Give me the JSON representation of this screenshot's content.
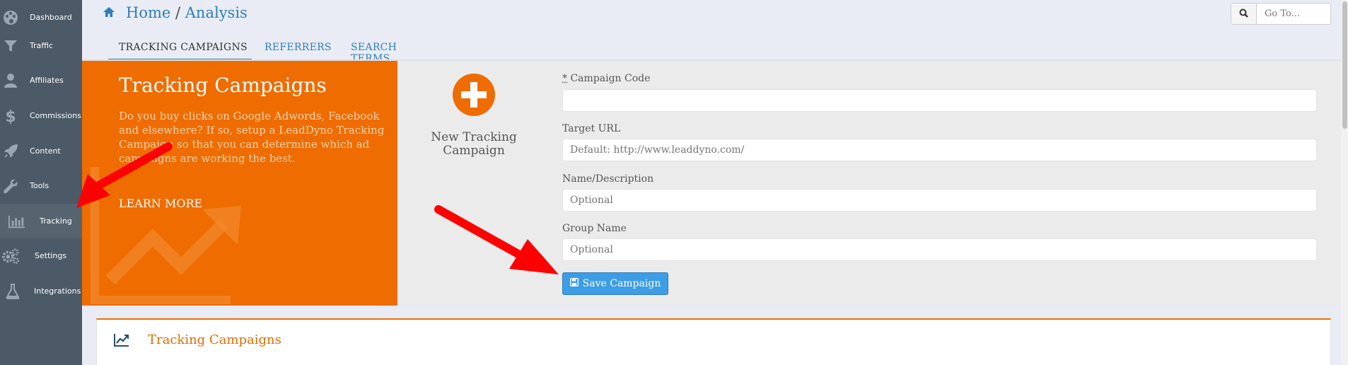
{
  "sidebar": {
    "items": [
      {
        "label": "Dashboard",
        "icon": "palette-icon"
      },
      {
        "label": "Traffic",
        "icon": "filter-icon"
      },
      {
        "label": "Affiliates",
        "icon": "user-icon"
      },
      {
        "label": "Commissions",
        "icon": "dollar-icon"
      },
      {
        "label": "Content",
        "icon": "rocket-icon"
      },
      {
        "label": "Tools",
        "icon": "wrench-icon"
      },
      {
        "label": "Tracking",
        "icon": "bar-chart-icon"
      },
      {
        "label": "Settings",
        "icon": "gears-icon"
      },
      {
        "label": "Integrations",
        "icon": "flask-icon"
      }
    ],
    "active": "Tracking"
  },
  "breadcrumb": {
    "home": "Home",
    "separator": "/",
    "current": "Analysis"
  },
  "goto": {
    "placeholder": "Go To..."
  },
  "tabs": [
    {
      "label": "TRACKING CAMPAIGNS",
      "active": true
    },
    {
      "label": "REFERRERS",
      "active": false
    },
    {
      "label": "SEARCH TERMS",
      "active": false
    }
  ],
  "promo": {
    "title": "Tracking Campaigns",
    "text": "Do you buy clicks on Google Adwords, Facebook and elsewhere? If so, setup a LeadDyno Tracking Campaign so that you can determine which ad campaigns are working the best.",
    "link": "LEARN MORE"
  },
  "new_campaign": {
    "label_line1": "New Tracking",
    "label_line2": "Campaign"
  },
  "form": {
    "campaign_code": {
      "required_mark": "*",
      "label": "Campaign Code",
      "value": "",
      "placeholder": ""
    },
    "target_url": {
      "label": "Target URL",
      "placeholder": "Default: http://www.leaddyno.com/"
    },
    "name": {
      "label": "Name/Description",
      "placeholder": "Optional"
    },
    "group": {
      "label": "Group Name",
      "placeholder": "Optional"
    },
    "save_label": "Save Campaign"
  },
  "panel": {
    "title": "Tracking Campaigns"
  },
  "colors": {
    "accent": "#2f7dba",
    "brand_orange": "#ef6c00",
    "sidebar": "#4b5a66",
    "button": "#3d9de6",
    "annotation_arrow": "#ff0000"
  }
}
